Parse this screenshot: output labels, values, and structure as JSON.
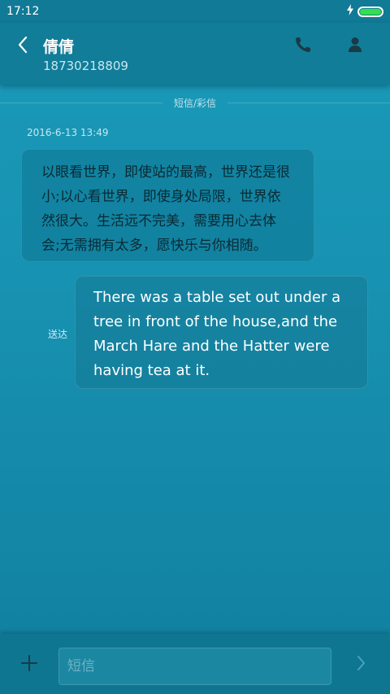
{
  "status_bar": {
    "time": "17:12",
    "charging_icon": "lightning-icon",
    "battery_icon": "battery-icon",
    "battery_level": 1.0
  },
  "header": {
    "back_icon": "chevron-left-icon",
    "contact_name": "倩倩",
    "contact_number": "18730218809",
    "call_icon": "phone-icon",
    "profile_icon": "person-icon"
  },
  "conversation": {
    "type_label": "短信/彩信",
    "timestamp": "2016-6-13 13:49",
    "messages": [
      {
        "direction": "incoming",
        "text": "以眼看世界，即使站的最高，世界还是很小;以心看世界，即使身处局限，世界依然很大。生活远不完美，需要用心去体会;无需拥有太多，愿快乐与你相随。"
      },
      {
        "direction": "outgoing",
        "status": "送达",
        "text": "There was a table set out under a tree in front of the house,and the March Hare and the Hatter were having tea at it."
      }
    ]
  },
  "composer": {
    "add_icon": "plus-icon",
    "placeholder": "短信",
    "value": "",
    "send_icon": "chevron-right-icon"
  },
  "colors": {
    "background": "#1892b2",
    "bar": "#117d99",
    "battery": "#33e04a"
  }
}
